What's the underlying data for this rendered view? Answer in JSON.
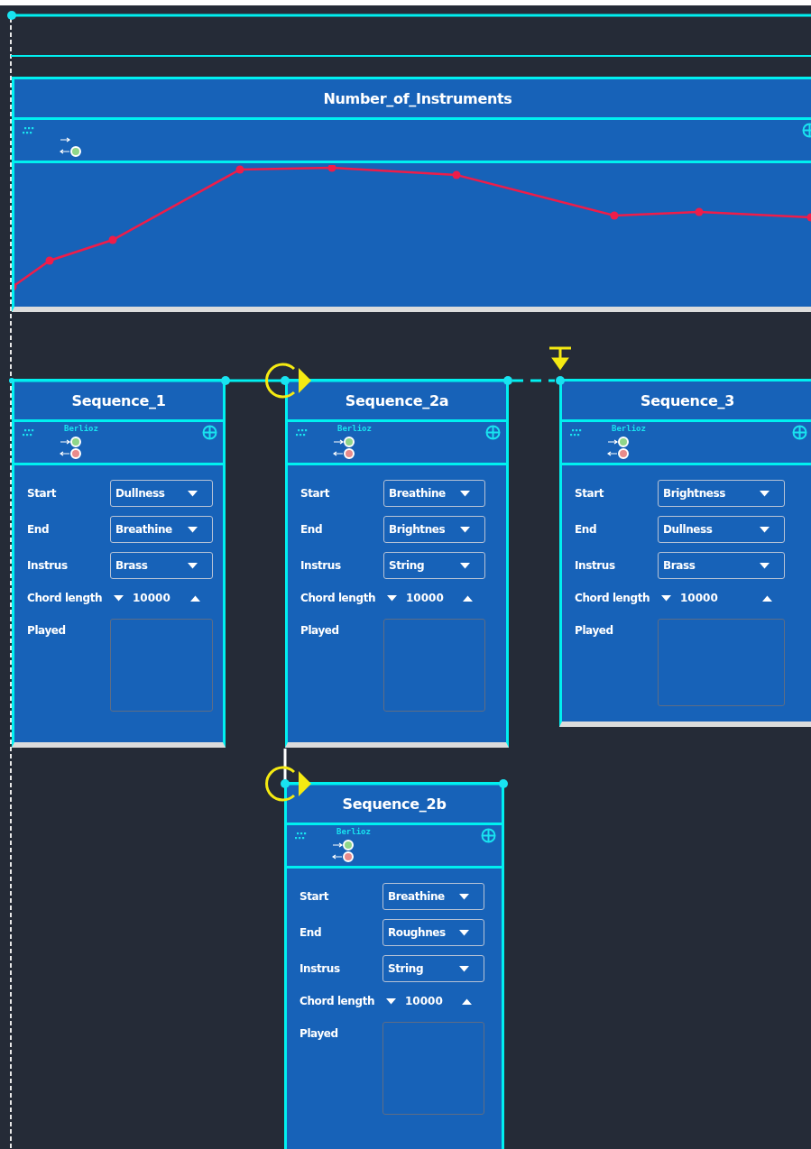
{
  "canvas": {
    "nodes": [
      {
        "kind": "chart",
        "title": "Number_of_Instruments"
      },
      {
        "kind": "sequence",
        "title": "Sequence_1",
        "composer": "Berlioz",
        "fields": [
          {
            "label": "Start",
            "value": "Dullness"
          },
          {
            "label": "End",
            "value": "Breathine"
          },
          {
            "label": "Instrus",
            "value": "Brass"
          }
        ],
        "chord_length": {
          "label": "Chord length",
          "value": "10000"
        },
        "played": {
          "label": "Played"
        }
      },
      {
        "kind": "sequence",
        "title": "Sequence_2a",
        "composer": "Berlioz",
        "fields": [
          {
            "label": "Start",
            "value": "Breathine"
          },
          {
            "label": "End",
            "value": "Brightnes"
          },
          {
            "label": "Instrus",
            "value": "String"
          }
        ],
        "chord_length": {
          "label": "Chord length",
          "value": "10000"
        },
        "played": {
          "label": "Played"
        }
      },
      {
        "kind": "sequence",
        "title": "Sequence_3",
        "composer": "Berlioz",
        "fields": [
          {
            "label": "Start",
            "value": "Brightness"
          },
          {
            "label": "End",
            "value": "Dullness"
          },
          {
            "label": "Instrus",
            "value": "Brass"
          }
        ],
        "chord_length": {
          "label": "Chord length",
          "value": "10000"
        },
        "played": {
          "label": "Played"
        }
      },
      {
        "kind": "sequence",
        "title": "Sequence_2b",
        "composer": "Berlioz",
        "fields": [
          {
            "label": "Start",
            "value": "Breathine"
          },
          {
            "label": "End",
            "value": "Roughnes"
          },
          {
            "label": "Instrus",
            "value": "String"
          }
        ],
        "chord_length": {
          "label": "Chord length",
          "value": "10000"
        },
        "played": {
          "label": "Played"
        }
      }
    ]
  }
}
